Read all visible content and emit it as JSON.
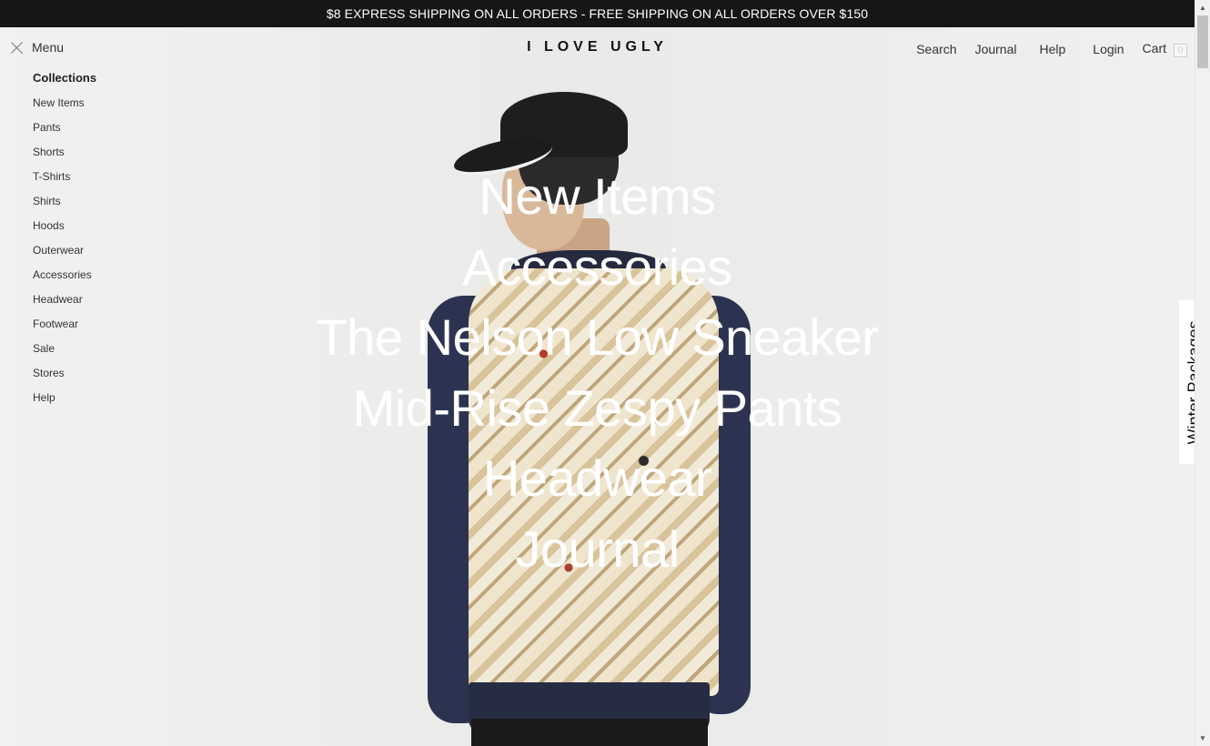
{
  "promo": {
    "text": "$8 EXPRESS SHIPPING ON ALL ORDERS - FREE SHIPPING ON ALL ORDERS OVER $150"
  },
  "header": {
    "menu_label": "Menu",
    "logo": "I LOVE UGLY",
    "nav": {
      "search": "Search",
      "journal": "Journal",
      "help": "Help",
      "login": "Login",
      "cart": "Cart",
      "cart_count": "0"
    }
  },
  "sidebar": {
    "heading": "Collections",
    "items": [
      "New Items",
      "Pants",
      "Shorts",
      "T-Shirts",
      "Shirts",
      "Hoods",
      "Outerwear",
      "Accessories",
      "Headwear",
      "Footwear",
      "Sale",
      "Stores",
      "Help"
    ]
  },
  "hero_links": [
    "New Items",
    "Accessories",
    "The Nelson Low Sneaker",
    "Mid-Rise Zespy Pants",
    "Headwear",
    "Journal"
  ],
  "side_tab": {
    "label": "Winter Packages"
  },
  "icons": {
    "menu_close": "close-icon",
    "scroll_up": "scroll-up-icon",
    "scroll_down": "scroll-down-icon"
  },
  "colors": {
    "promo_bg": "#161616",
    "overlay_text": "#ffffff",
    "page_bg": "#efefed"
  }
}
